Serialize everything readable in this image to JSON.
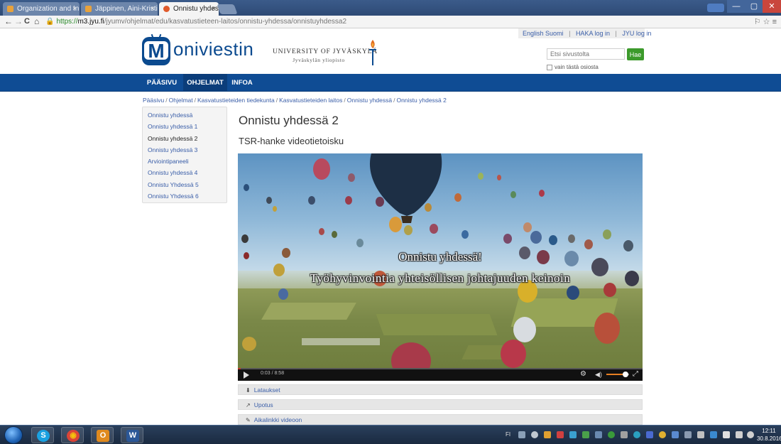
{
  "browser": {
    "tabs": [
      {
        "title": "Organization and In",
        "close": "×",
        "favicon_color": "#e8a23c"
      },
      {
        "title": "Jäppinen, Aini-Kristi",
        "close": "×",
        "favicon_color": "#e8a23c"
      },
      {
        "title": "Onnistu yhdessä 2 –",
        "close": "×",
        "favicon_color": "#e05a2b"
      }
    ],
    "url_lock": "🔒",
    "url_scheme": "https://",
    "url_domain": "m3.jyu.fi",
    "url_path": "/jyumv/ohjelmat/edu/kasvatustieteen-laitos/onnistu-yhdessa/onnistuyhdessa2",
    "nav_back": "←",
    "nav_forward": "→",
    "nav_reload": "C",
    "nav_home": "⌂",
    "addr_right": "⚐ ☆ ≡",
    "window_min": "—",
    "window_max": "▢",
    "window_close": "✕"
  },
  "site": {
    "toplinks": {
      "english": "English",
      "suomi": "Suomi",
      "sep": "|",
      "haka": "HAKA log in",
      "jyu": "JYU log in"
    },
    "logo_letter": "M",
    "logo_text": "oniviestin",
    "university_name": "UNIVERSITY OF JYVÄSKYLÄ",
    "university_sub": "Jyväskylän yliopisto",
    "search_placeholder": "Etsi sivustolta",
    "search_button": "Hae",
    "search_scope_label": "vain tästä osiosta",
    "nav": [
      {
        "label": "PÄÄSIVU"
      },
      {
        "label": "OHJELMAT"
      },
      {
        "label": "INFOA"
      }
    ],
    "breadcrumb": [
      "Pääsivu",
      "Ohjelmat",
      "Kasvatustieteiden tiedekunta",
      "Kasvatustieteiden laitos",
      "Onnistu yhdessä",
      "Onnistu yhdessä 2"
    ],
    "breadcrumb_sep": "/",
    "sidebar": [
      {
        "label": "Onnistu yhdessä"
      },
      {
        "label": "Onnistu yhdessä 1"
      },
      {
        "label": "Onnistu yhdessä 2"
      },
      {
        "label": "Onnistu yhdessä 3"
      },
      {
        "label": "Arviointipaneeli"
      },
      {
        "label": "Onnistu yhdessä 4"
      },
      {
        "label": "Onnistu Yhdessä 5"
      },
      {
        "label": "Onnistu Yhdessä 6"
      }
    ],
    "title": "Onnistu yhdessä 2",
    "subtitle": "TSR-hanke videotietoisku"
  },
  "video": {
    "caption_line1": "Onnistu yhdessä!",
    "caption_line2": "Työhyvinvointia yhteisöllisen johtajuuden keinoin",
    "time": "0:03 / 8:58",
    "progress": 0.006,
    "volume": 0.85,
    "gear": "⚙",
    "speaker": "◀)",
    "fullscreen": "⤢"
  },
  "actions": [
    {
      "icon": "⬇",
      "label": "Lataukset"
    },
    {
      "icon": "↗",
      "label": "Upotus"
    },
    {
      "icon": "✎",
      "label": "Aikalinkki videoon"
    }
  ],
  "taskbar": {
    "apps": [
      {
        "name": "skype",
        "glyph": "S",
        "color": "#1aa1e1"
      },
      {
        "name": "chrome",
        "glyph": "◉",
        "color": "#db4437"
      },
      {
        "name": "outlook",
        "glyph": "O",
        "color": "#e08a1e"
      },
      {
        "name": "word",
        "glyph": "W",
        "color": "#2b5797"
      }
    ],
    "lang": "FI",
    "clock_time": "12:11",
    "clock_date": "30.8.2016"
  }
}
